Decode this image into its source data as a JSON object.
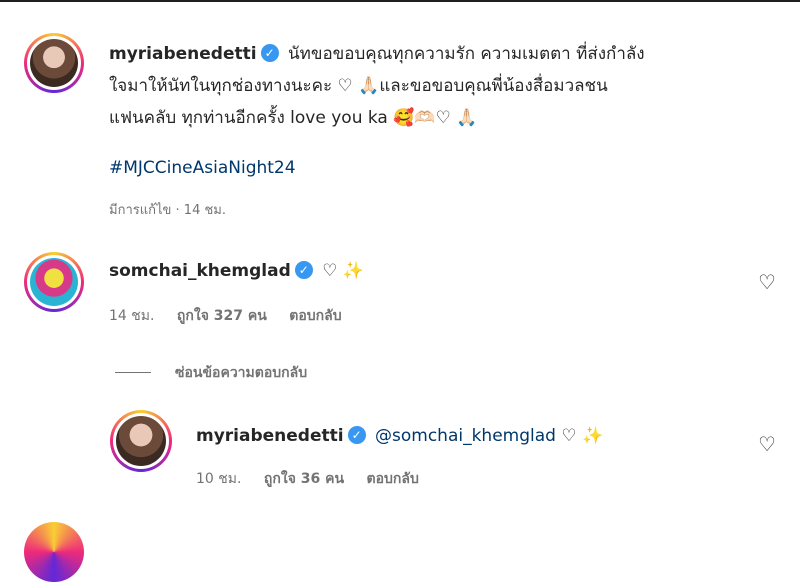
{
  "post": {
    "username": "myriabenedetti",
    "caption_line1": "นัทขอขอบคุณทุกความรัก ความเมตตา ที่ส่งกำลัง",
    "caption_line2": "ใจมาให้นัทในทุกช่องทางนะคะ ♡ 🙏🏻และขอขอบคุณพี่น้องสื่อมวลชน",
    "caption_line3": "แฟนคลับ ทุกท่านอีกครั้ง love you ka 🥰🫶🏻♡ 🙏🏻",
    "hashtag": "#MJCCineAsiaNight24",
    "meta": "มีการแก้ไข · 14 ชม."
  },
  "comment1": {
    "username": "somchai_khemglad",
    "text": "♡ ✨",
    "time": "14 ชม.",
    "likes": "ถูกใจ 327 คน",
    "reply": "ตอบกลับ"
  },
  "hide_replies": "ซ่อนข้อความตอบกลับ",
  "reply1": {
    "username": "myriabenedetti",
    "mention": "@somchai_khemglad",
    "text": "♡ ✨",
    "time": "10 ชม.",
    "likes": "ถูกใจ 36 คน",
    "reply": "ตอบกลับ"
  },
  "icons": {
    "verified": "verified-badge-icon",
    "heart": "heart-outline-icon"
  },
  "colors": {
    "link": "#00376b",
    "muted": "#737373",
    "verified": "#3897f0"
  }
}
